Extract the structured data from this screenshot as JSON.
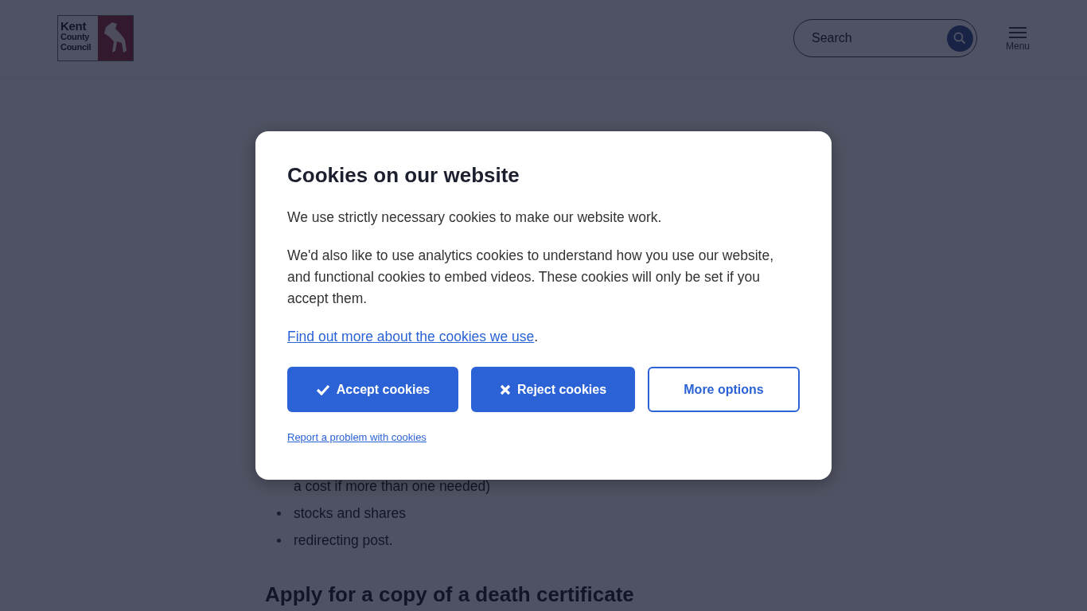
{
  "header": {
    "logo_text": [
      "Kent",
      "County",
      "Council"
    ],
    "search": {
      "placeholder": "Search"
    },
    "menu_label": "Menu"
  },
  "background": {
    "continuation": "a cost if more than one needed)",
    "list_items": [
      "stocks and shares",
      "redirecting post."
    ],
    "heading": "Apply for a copy of a death certificate"
  },
  "cookie_banner": {
    "title": "Cookies on our website",
    "paragraphs": [
      "We use strictly necessary cookies to make our website work.",
      "We'd also like to use analytics cookies to understand how you use our website, and functional cookies to embed videos. These cookies will only be set if you accept them."
    ],
    "link": {
      "text": "Find out more about the cookies we use",
      "suffix": "."
    },
    "buttons": [
      {
        "label": "Accept cookies",
        "kind": "accept"
      },
      {
        "label": "Reject cookies",
        "kind": "reject"
      },
      {
        "label": "More options",
        "kind": "options"
      }
    ],
    "report_link": "Report a problem with cookies"
  }
}
